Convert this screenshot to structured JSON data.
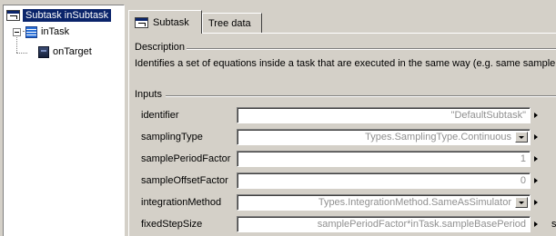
{
  "tree": {
    "root_label": "Subtask inSubtask",
    "child_label": "inTask",
    "grandchild_label": "onTarget"
  },
  "tabs": [
    {
      "label": "Subtask"
    },
    {
      "label": "Tree data"
    }
  ],
  "description": {
    "title": "Description",
    "text": "Identifies a set of equations inside a task that are executed in the same way (e.g. same sample pe"
  },
  "inputs": {
    "title": "Inputs",
    "fields": [
      {
        "label": "identifier",
        "value": "\"DefaultSubtask\"",
        "dropdown": false
      },
      {
        "label": "samplingType",
        "value": "Types.SamplingType.Continuous",
        "dropdown": true
      },
      {
        "label": "samplePeriodFactor",
        "value": "1",
        "dropdown": false
      },
      {
        "label": "sampleOffsetFactor",
        "value": "0",
        "dropdown": false
      },
      {
        "label": "integrationMethod",
        "value": "Types.IntegrationMethod.SameAsSimulator",
        "dropdown": true
      },
      {
        "label": "fixedStepSize",
        "value": "samplePeriodFactor*inTask.sampleBasePeriod",
        "dropdown": false,
        "unit": "s"
      }
    ]
  },
  "colors": {
    "selection": "#0a246a",
    "window_bg": "#d4d0c8",
    "field_text": "#909090"
  }
}
